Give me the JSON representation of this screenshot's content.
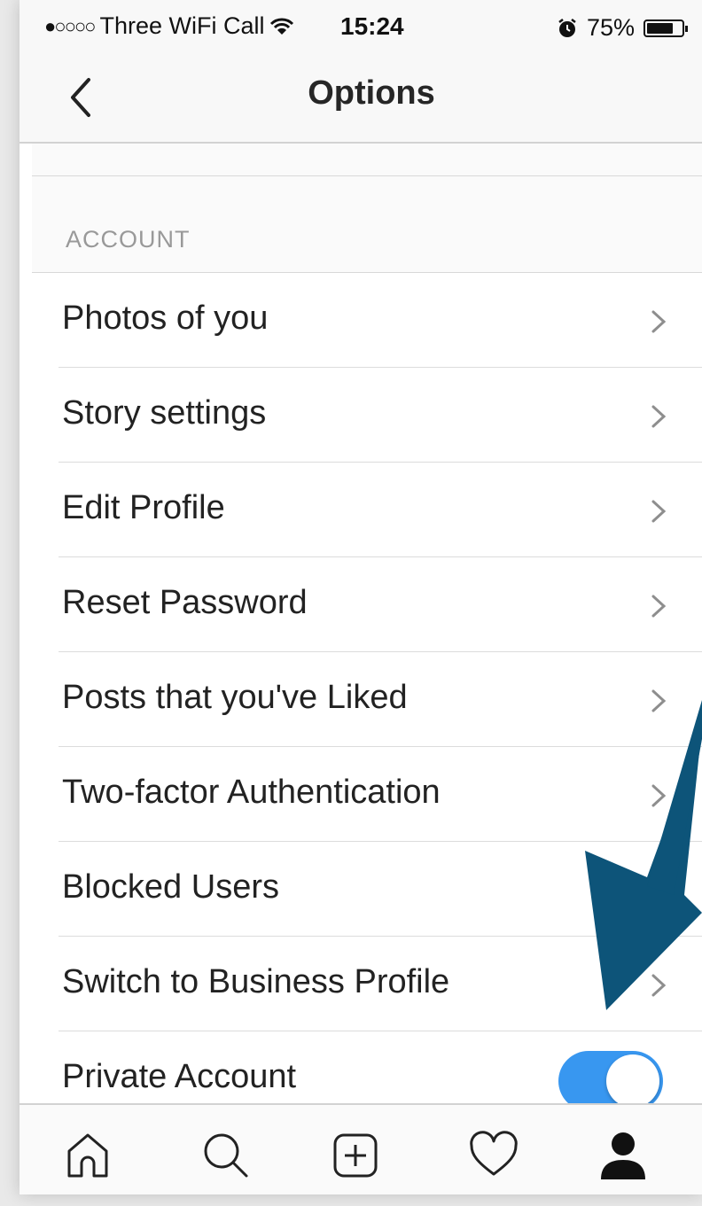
{
  "status_bar": {
    "signal_dots": "●○○○○",
    "carrier": "Three WiFi Call",
    "time": "15:24",
    "battery_percent": "75%",
    "battery_level": 0.75
  },
  "nav": {
    "title": "Options"
  },
  "section": {
    "header": "ACCOUNT"
  },
  "rows": [
    {
      "label": "Photos of you",
      "accessory": "chevron"
    },
    {
      "label": "Story settings",
      "accessory": "chevron"
    },
    {
      "label": "Edit Profile",
      "accessory": "chevron"
    },
    {
      "label": "Reset Password",
      "accessory": "chevron"
    },
    {
      "label": "Posts that you've Liked",
      "accessory": "chevron"
    },
    {
      "label": "Two-factor Authentication",
      "accessory": "chevron"
    },
    {
      "label": "Blocked Users",
      "accessory": "chevron"
    },
    {
      "label": "Switch to Business Profile",
      "accessory": "chevron"
    },
    {
      "label": "Private Account",
      "accessory": "toggle",
      "on": true
    }
  ],
  "tabs": [
    {
      "icon": "home-icon"
    },
    {
      "icon": "search-icon"
    },
    {
      "icon": "add-post-icon"
    },
    {
      "icon": "heart-icon"
    },
    {
      "icon": "profile-icon",
      "active": true
    }
  ],
  "colors": {
    "toggle_on": "#3897f0",
    "annotation_arrow": "#0d5479"
  }
}
